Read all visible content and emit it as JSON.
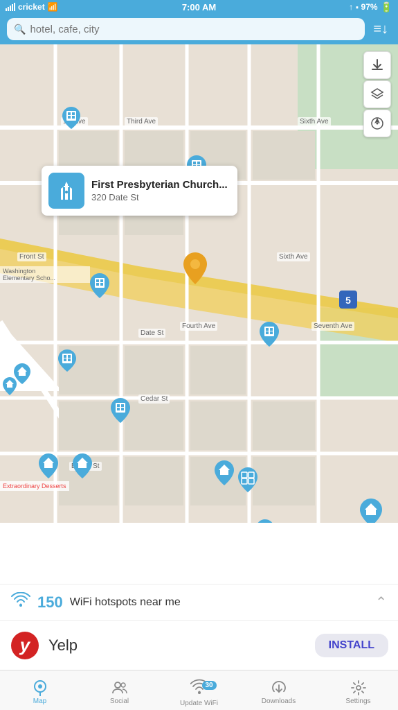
{
  "statusBar": {
    "carrier": "cricket",
    "time": "7:00 AM",
    "battery": "97%"
  },
  "searchBar": {
    "placeholder": "hotel, cafe, city",
    "filterIcon": "≡↓"
  },
  "map": {
    "poi": {
      "name": "First Presbyterian Church...",
      "address": "320 Date St"
    },
    "controls": [
      "download",
      "layers",
      "location"
    ],
    "wifiCount": "150",
    "wifiLabel": "WiFi hotspots near me"
  },
  "ad": {
    "brand": "Yelp",
    "installLabel": "INSTALL"
  },
  "tabBar": {
    "items": [
      {
        "id": "map",
        "label": "Map",
        "active": true
      },
      {
        "id": "social",
        "label": "Social",
        "active": false
      },
      {
        "id": "update-wifi",
        "label": "Update WiFi",
        "active": false,
        "badge": "30"
      },
      {
        "id": "downloads",
        "label": "Downloads",
        "active": false
      },
      {
        "id": "settings",
        "label": "Settings",
        "active": false
      }
    ]
  }
}
